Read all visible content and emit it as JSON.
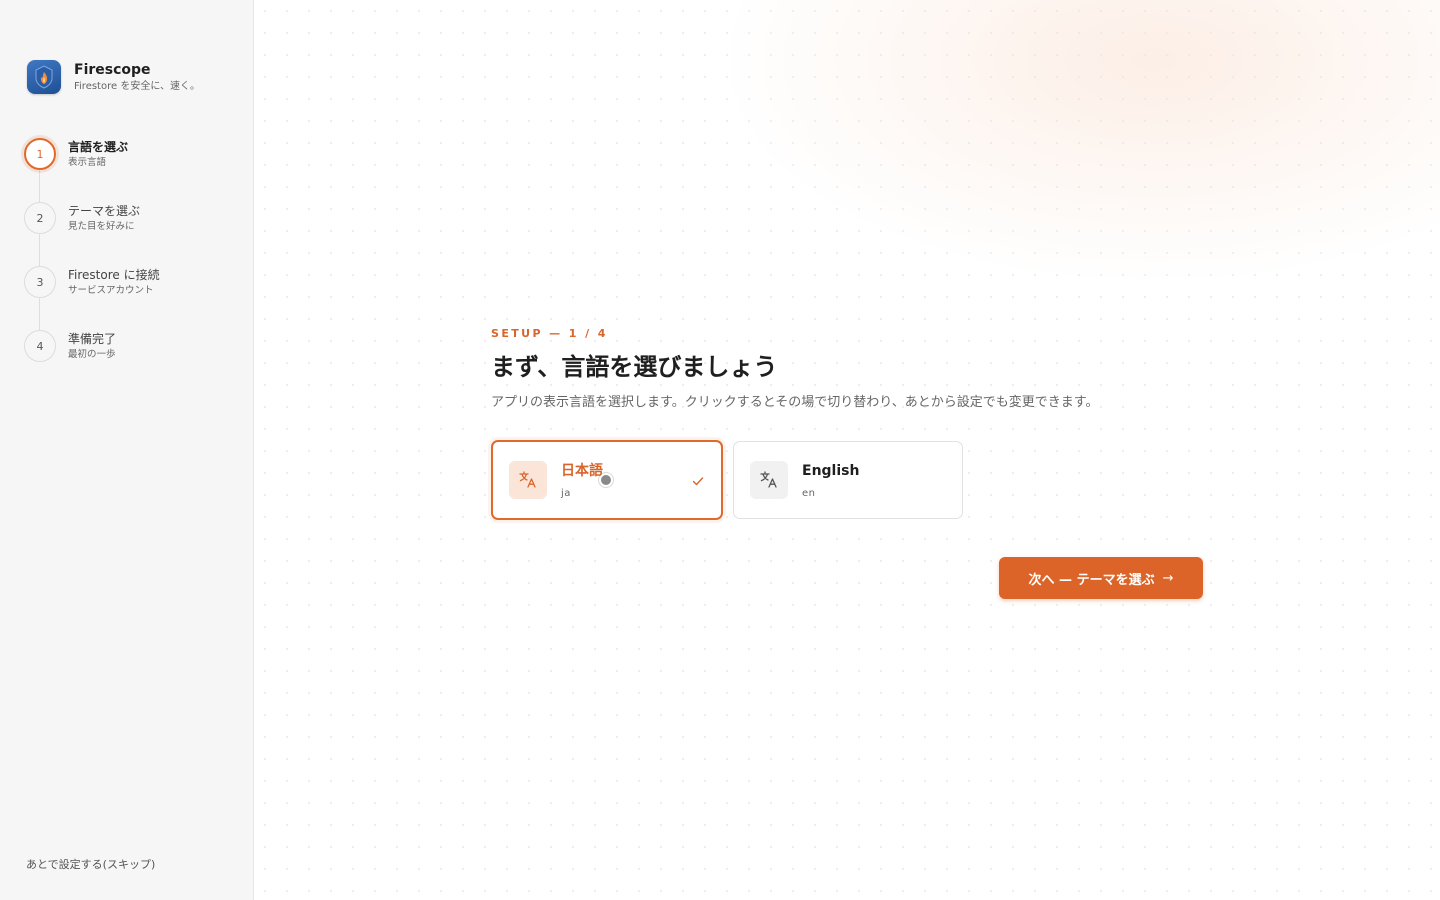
{
  "app": {
    "name": "Firescope",
    "tagline": "Firestore を安全に、速く。"
  },
  "steps": [
    {
      "number": "1",
      "title": "言語を選ぶ",
      "subtitle": "表示言語",
      "active": true
    },
    {
      "number": "2",
      "title": "テーマを選ぶ",
      "subtitle": "見た目を好みに",
      "active": false
    },
    {
      "number": "3",
      "title": "Firestore に接続",
      "subtitle": "サービスアカウント",
      "active": false
    },
    {
      "number": "4",
      "title": "準備完了",
      "subtitle": "最初の一歩",
      "active": false
    }
  ],
  "skip_label": "あとで設定する(スキップ)",
  "main": {
    "eyebrow": "SETUP — 1 / 4",
    "headline": "まず、言語を選びましょう",
    "description": "アプリの表示言語を選択します。クリックするとその場で切り替わり、あとから設定でも変更できます。",
    "languages": [
      {
        "label": "日本語",
        "code": "ja",
        "selected": true,
        "icon": "translate-icon"
      },
      {
        "label": "English",
        "code": "en",
        "selected": false,
        "icon": "translate-icon"
      }
    ],
    "next_button": {
      "label": "次へ — テーマを選ぶ",
      "icon": "arrow-right-icon"
    }
  },
  "colors": {
    "accent": "#dd6428",
    "accent_soft": "#fbe5d9",
    "sidebar_bg": "#f6f6f6"
  }
}
